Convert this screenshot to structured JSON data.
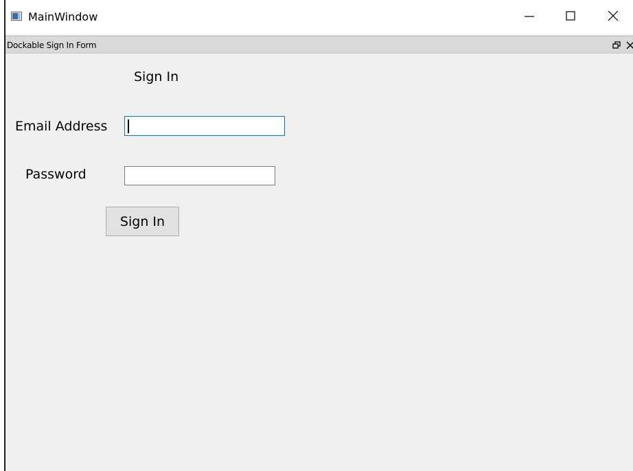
{
  "window": {
    "title": "MainWindow"
  },
  "titlebar_buttons": {
    "minimize_icon": "minimize-icon",
    "maximize_icon": "maximize-icon",
    "close_icon": "close-icon"
  },
  "dock": {
    "title": "Dockable Sign In Form",
    "float_icon": "float-icon",
    "close_icon": "close-icon"
  },
  "form": {
    "heading": "Sign In",
    "email_label": "Email Address",
    "email_value": "",
    "password_label": "Password",
    "password_value": "",
    "submit_label": "Sign In"
  },
  "colors": {
    "focus_border": "#0078d7",
    "window_bg": "#f0f0f0",
    "dock_titlebar_bg": "#d9d9d9"
  }
}
